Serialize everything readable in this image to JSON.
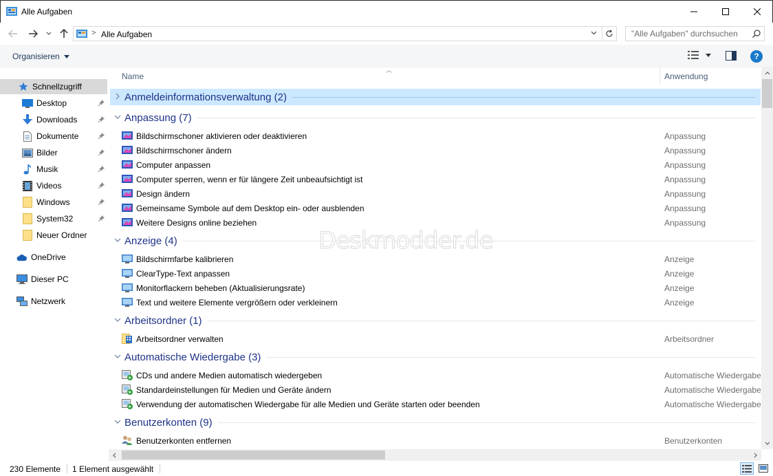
{
  "window": {
    "title": "Alle Aufgaben",
    "icon": "control-panel-icon"
  },
  "address": {
    "crumb": "Alle Aufgaben",
    "separator": ">",
    "search_placeholder": "\"Alle Aufgaben\" durchsuchen"
  },
  "toolbar": {
    "organize_label": "Organisieren",
    "help_label": "?"
  },
  "sidebar": {
    "items": [
      {
        "label": "Schnellzugriff",
        "icon": "star-icon",
        "pinned": false
      },
      {
        "label": "Desktop",
        "icon": "desktop-icon",
        "pinned": true
      },
      {
        "label": "Downloads",
        "icon": "download-icon",
        "pinned": true
      },
      {
        "label": "Dokumente",
        "icon": "document-icon",
        "pinned": true
      },
      {
        "label": "Bilder",
        "icon": "pictures-icon",
        "pinned": true
      },
      {
        "label": "Musik",
        "icon": "music-icon",
        "pinned": true
      },
      {
        "label": "Videos",
        "icon": "video-icon",
        "pinned": true
      },
      {
        "label": "Windows",
        "icon": "folder-icon",
        "pinned": true
      },
      {
        "label": "System32",
        "icon": "folder-icon",
        "pinned": true
      },
      {
        "label": "Neuer Ordner",
        "icon": "folder-icon",
        "pinned": false
      },
      {
        "label": "OneDrive",
        "icon": "cloud-icon",
        "pinned": false
      },
      {
        "label": "Dieser PC",
        "icon": "computer-icon",
        "pinned": false
      },
      {
        "label": "Netzwerk",
        "icon": "network-icon",
        "pinned": false
      }
    ]
  },
  "columns": {
    "name": "Name",
    "app": "Anwendung"
  },
  "groups": [
    {
      "title": "Anmeldeinformationsverwaltung (2)",
      "expanded": false,
      "selected": true,
      "items": []
    },
    {
      "title": "Anpassung (7)",
      "expanded": true,
      "selected": false,
      "items": [
        {
          "name": "Bildschirmschoner aktivieren oder deaktivieren",
          "app": "Anpassung"
        },
        {
          "name": "Bildschirmschoner ändern",
          "app": "Anpassung"
        },
        {
          "name": "Computer anpassen",
          "app": "Anpassung"
        },
        {
          "name": "Computer sperren, wenn er für längere Zeit unbeaufsichtigt ist",
          "app": "Anpassung"
        },
        {
          "name": "Design ändern",
          "app": "Anpassung"
        },
        {
          "name": "Gemeinsame Symbole auf dem Desktop ein- oder ausblenden",
          "app": "Anpassung"
        },
        {
          "name": "Weitere Designs online beziehen",
          "app": "Anpassung"
        }
      ]
    },
    {
      "title": "Anzeige (4)",
      "expanded": true,
      "selected": false,
      "items": [
        {
          "name": "Bildschirmfarbe kalibrieren",
          "app": "Anzeige"
        },
        {
          "name": "ClearType-Text anpassen",
          "app": "Anzeige"
        },
        {
          "name": "Monitorflackern beheben (Aktualisierungsrate)",
          "app": "Anzeige"
        },
        {
          "name": "Text und weitere Elemente vergrößern oder verkleinern",
          "app": "Anzeige"
        }
      ]
    },
    {
      "title": "Arbeitsordner (1)",
      "expanded": true,
      "selected": false,
      "items": [
        {
          "name": "Arbeitsordner verwalten",
          "app": "Arbeitsordner"
        }
      ]
    },
    {
      "title": "Automatische Wiedergabe (3)",
      "expanded": true,
      "selected": false,
      "items": [
        {
          "name": "CDs und andere Medien automatisch wiedergeben",
          "app": "Automatische Wiedergabe"
        },
        {
          "name": "Standardeinstellungen für Medien und Geräte ändern",
          "app": "Automatische Wiedergabe"
        },
        {
          "name": "Verwendung der automatischen Wiedergabe für alle Medien und Geräte starten oder beenden",
          "app": "Automatische Wiedergabe"
        }
      ]
    },
    {
      "title": "Benutzerkonten (9)",
      "expanded": true,
      "selected": false,
      "items": [
        {
          "name": "Benutzerkonten entfernen",
          "app": "Benutzerkonten"
        }
      ]
    }
  ],
  "watermark": "Deskmodder.de",
  "status": {
    "count": "230 Elemente",
    "selection": "1 Element ausgewählt"
  },
  "colors": {
    "group_title": "#1e3287",
    "selection": "#cce8ff",
    "link": "#1e395b",
    "help": "#1979ca"
  }
}
